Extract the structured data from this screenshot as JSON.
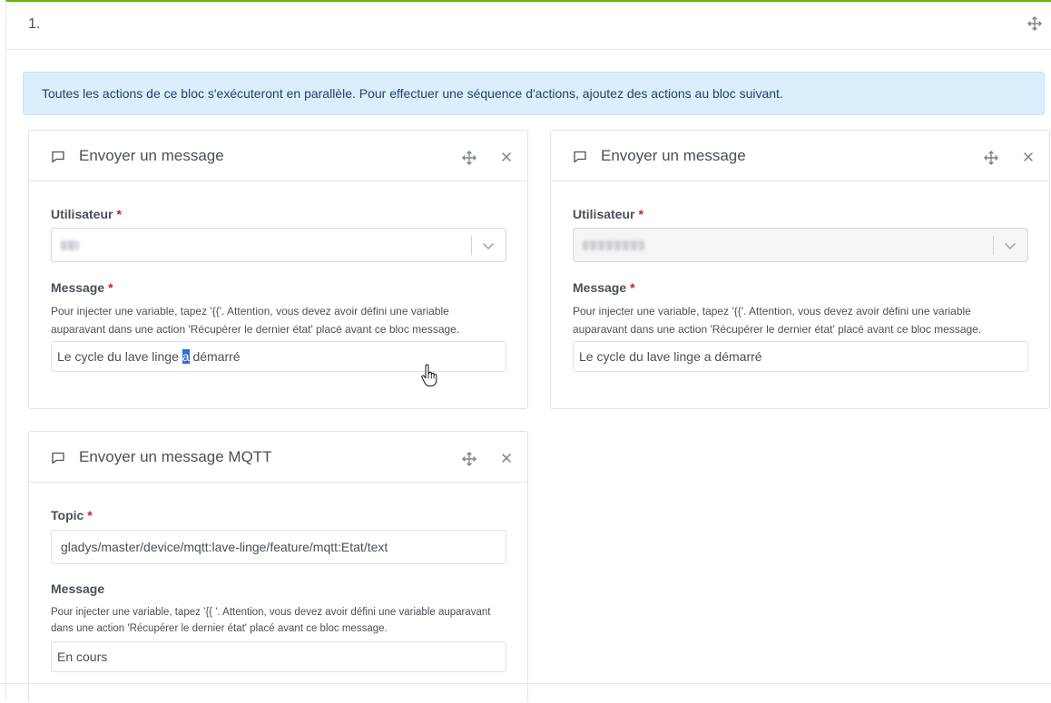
{
  "block": {
    "number": "1."
  },
  "alert": {
    "text": "Toutes les actions de ce bloc s'exécuteront en parallèle. Pour effectuer une séquence d'actions, ajoutez des actions au bloc suivant."
  },
  "cards": [
    {
      "title": "Envoyer un message",
      "user_label": "Utilisateur",
      "message_label": "Message",
      "help": "Pour injecter une variable, tapez '{{'. Attention, vous devez avoir défini une variable auparavant dans une action 'Récupérer le dernier état' placé avant ce bloc message.",
      "message_before": "Le cycle du lave linge ",
      "message_selected": "a",
      "message_after": " démarré"
    },
    {
      "title": "Envoyer un message",
      "user_label": "Utilisateur",
      "message_label": "Message",
      "help": "Pour injecter une variable, tapez '{{'. Attention, vous devez avoir défini une variable auparavant dans une action 'Récupérer le dernier état' placé avant ce bloc message.",
      "message_value": "Le cycle du lave linge a démarré"
    },
    {
      "title": "Envoyer un message MQTT",
      "topic_label": "Topic",
      "topic_value": "gladys/master/device/mqtt:lave-linge/feature/mqtt:Etat/text",
      "message_label": "Message",
      "help": "Pour injecter une variable, tapez '{{ '. Attention, vous devez avoir défini une variable auparavant dans une action 'Récupérer le dernier état' placé avant ce bloc message.",
      "message_value": "En cours"
    }
  ],
  "required_mark": "*",
  "icons": {
    "move": "move-arrows-icon",
    "close": "close-icon",
    "message": "message-square-icon",
    "chevron": "chevron-down-icon",
    "cursor": "hand-pointer-icon"
  },
  "colors": {
    "accent": "#5eba00",
    "alert_bg": "#daeefb",
    "required": "#cd201f",
    "selection": "#2e6cd6"
  }
}
